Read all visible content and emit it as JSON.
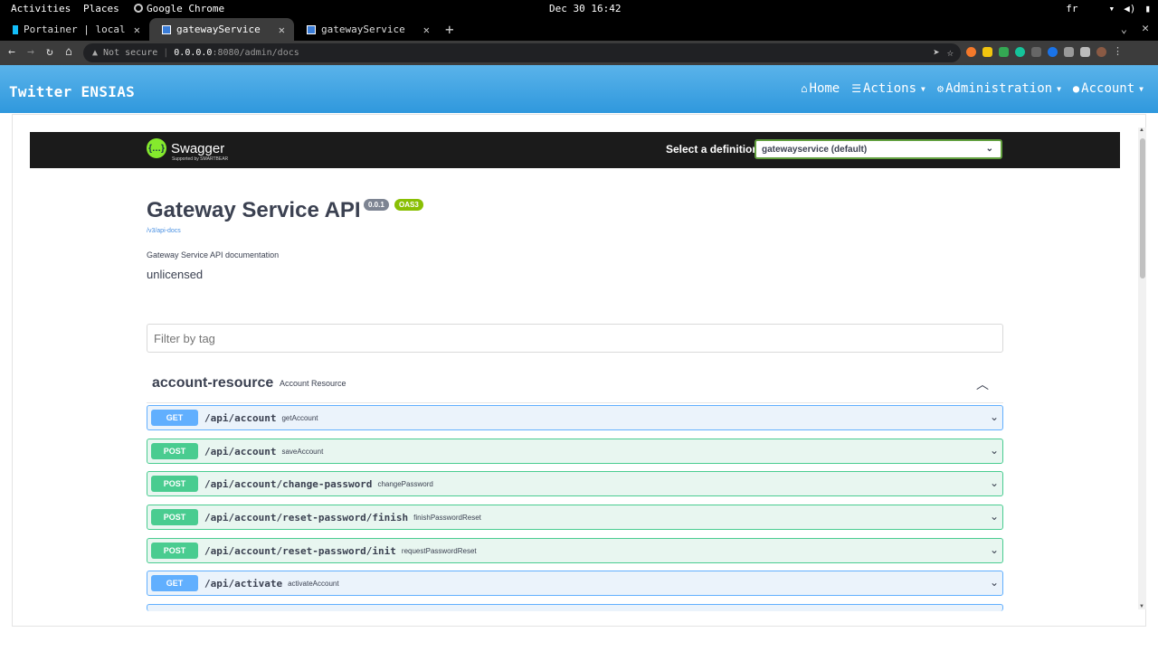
{
  "gnome": {
    "activities": "Activities",
    "places": "Places",
    "app_name": "Google Chrome",
    "datetime": "Dec 30 16:42",
    "lang": "fr"
  },
  "chrome": {
    "tabs": [
      {
        "title": "Portainer | local"
      },
      {
        "title": "gatewayService"
      },
      {
        "title": "gatewayService"
      }
    ],
    "address": {
      "security": "Not secure",
      "host": "0.0.0.0",
      "path": ":8080/admin/docs"
    }
  },
  "app": {
    "brand": "Twitter ENSIAS",
    "nav": {
      "home": "Home",
      "actions": "Actions",
      "administration": "Administration",
      "account": "Account"
    }
  },
  "swagger": {
    "logo_text": "Swagger",
    "logo_sub": "Supported by SMARTBEAR",
    "definition_label": "Select a definition",
    "definition_value": "gatewayservice (default)",
    "title": "Gateway Service API",
    "version": "0.0.1",
    "oas": "OAS3",
    "spec_link": "/v3/api-docs",
    "description": "Gateway Service API documentation",
    "license": "unlicensed",
    "filter_placeholder": "Filter by tag",
    "tag": {
      "name": "account-resource",
      "description": "Account Resource"
    },
    "operations": [
      {
        "method": "GET",
        "path": "/api/account",
        "summary": "getAccount"
      },
      {
        "method": "POST",
        "path": "/api/account",
        "summary": "saveAccount"
      },
      {
        "method": "POST",
        "path": "/api/account/change-password",
        "summary": "changePassword"
      },
      {
        "method": "POST",
        "path": "/api/account/reset-password/finish",
        "summary": "finishPasswordReset"
      },
      {
        "method": "POST",
        "path": "/api/account/reset-password/init",
        "summary": "requestPasswordReset"
      },
      {
        "method": "GET",
        "path": "/api/activate",
        "summary": "activateAccount"
      }
    ]
  },
  "colors": {
    "navbar": "#2f98dd",
    "get": "#61affe",
    "post": "#49cc90",
    "swagger_green": "#85ea2d"
  }
}
